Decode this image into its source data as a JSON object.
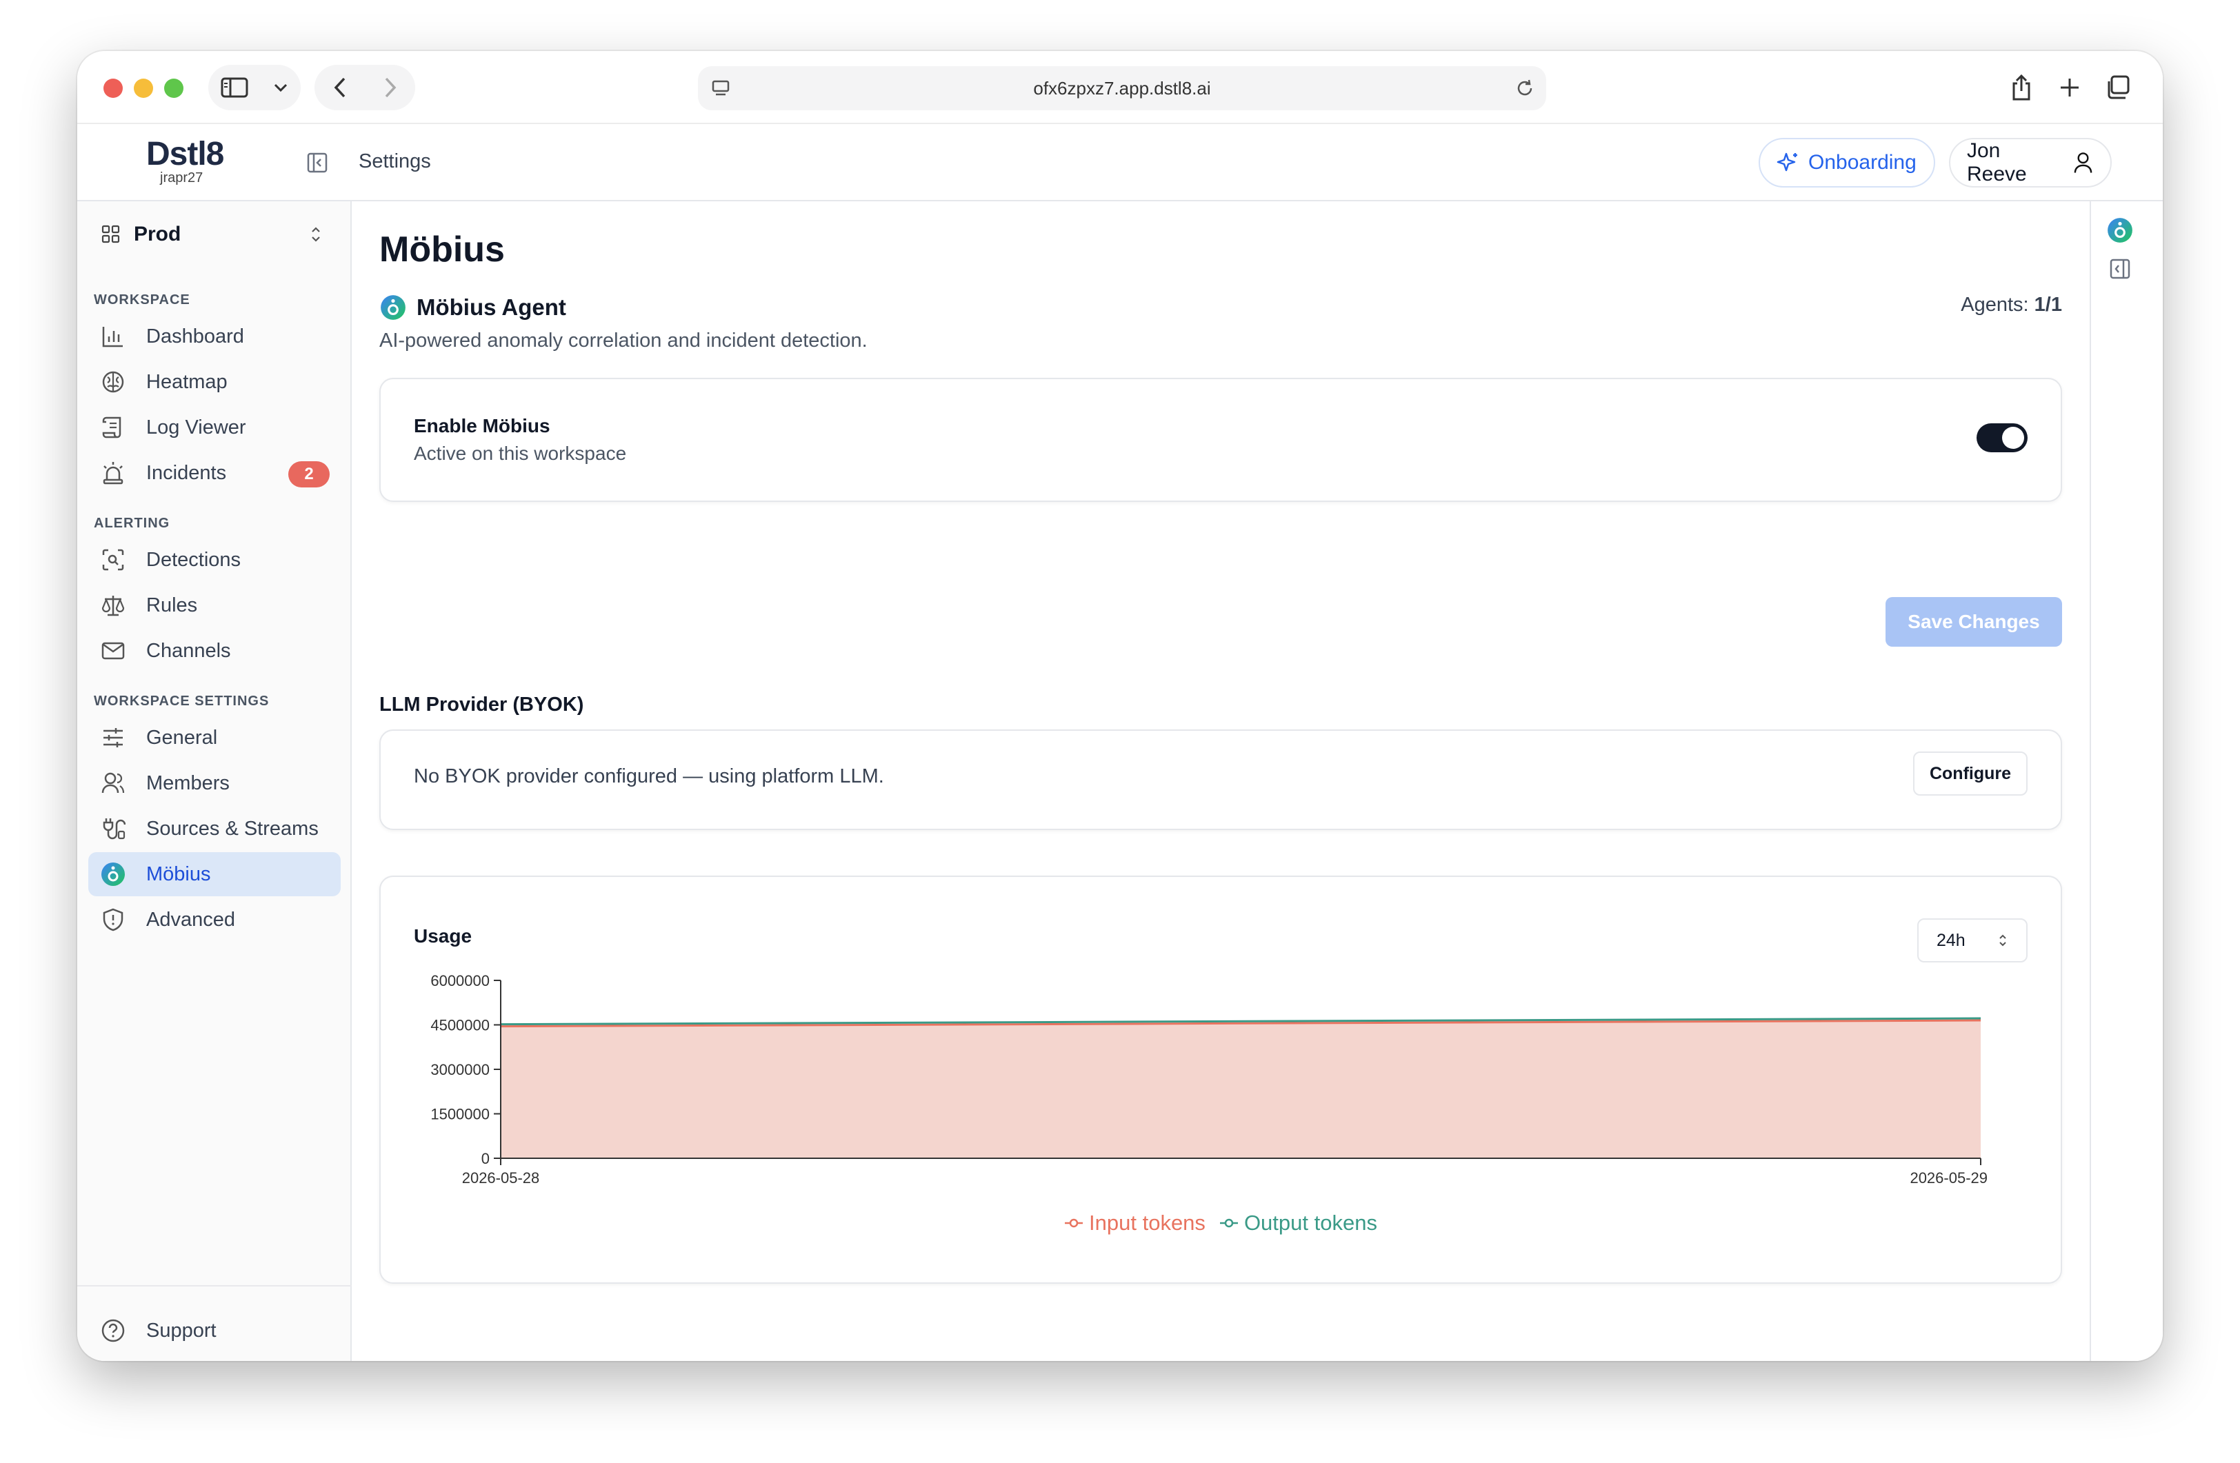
{
  "browser": {
    "url": "ofx6zpxz7.app.dstl8.ai"
  },
  "header": {
    "logo_text": "Dstl8",
    "tenant": "jrapr27",
    "breadcrumb": "Settings",
    "onboarding_label": "Onboarding",
    "user_name": "Jon Reeve"
  },
  "sidebar": {
    "workspace": "Prod",
    "sections": {
      "workspace": "WORKSPACE",
      "alerting": "ALERTING",
      "settings": "WORKSPACE SETTINGS"
    },
    "items": {
      "dashboard": "Dashboard",
      "heatmap": "Heatmap",
      "log_viewer": "Log Viewer",
      "incidents": "Incidents",
      "incidents_badge": "2",
      "detections": "Detections",
      "rules": "Rules",
      "channels": "Channels",
      "general": "General",
      "members": "Members",
      "sources": "Sources & Streams",
      "mobius": "Möbius",
      "advanced": "Advanced"
    },
    "support": "Support"
  },
  "main": {
    "title": "Möbius",
    "agent_title": "Möbius Agent",
    "agent_desc": "AI-powered anomaly correlation and incident detection.",
    "agents_label": "Agents:",
    "agents_value": "1/1",
    "enable_title": "Enable Möbius",
    "enable_sub": "Active on this workspace",
    "enabled": true,
    "save_label": "Save Changes",
    "llm_label": "LLM Provider (BYOK)",
    "llm_status": "No BYOK provider configured — using platform LLM.",
    "configure_label": "Configure",
    "usage_title": "Usage",
    "range_value": "24h"
  },
  "colors": {
    "input": "#e8735f",
    "input_fill": "#f4d5ce",
    "output": "#3a9a87",
    "accent": "#1d4ed8"
  },
  "chart_data": {
    "type": "area",
    "x": [
      "2026-05-28",
      "2026-05-29"
    ],
    "ylim": [
      0,
      6000000
    ],
    "yticks": [
      "0",
      "1500000",
      "3000000",
      "4500000",
      "6000000"
    ],
    "series": [
      {
        "name": "Input tokens",
        "values": [
          4450000,
          4650000
        ]
      },
      {
        "name": "Output tokens",
        "values": [
          4520000,
          4720000
        ]
      }
    ],
    "legend": "bottom"
  }
}
